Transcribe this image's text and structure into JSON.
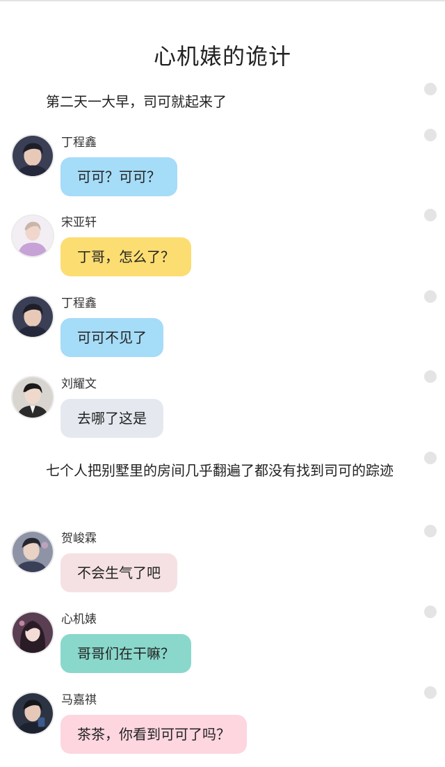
{
  "story": {
    "title": "心机婊的诡计"
  },
  "narrations": [
    {
      "text": "第二天一大早，司可就起来了"
    },
    {
      "text": "七个人把别墅里的房间几乎翻遍了都没有找到司可的踪迹"
    }
  ],
  "messages": [
    {
      "name": "丁程鑫",
      "text": "可可？可可？",
      "bubble_color": "#a5dcf8",
      "avatar": "avatar-ding-chengxin"
    },
    {
      "name": "宋亚轩",
      "text": "丁哥，怎么了？",
      "bubble_color": "#fcdd72",
      "avatar": "avatar-song-yaxuan"
    },
    {
      "name": "丁程鑫",
      "text": "可可不见了",
      "bubble_color": "#a5dcf8",
      "avatar": "avatar-ding-chengxin"
    },
    {
      "name": "刘耀文",
      "text": "去哪了这是",
      "bubble_color": "#e5e9ef",
      "avatar": "avatar-liu-yaowen"
    },
    {
      "name": "贺峻霖",
      "text": "不会生气了吧",
      "bubble_color": "#f5e1e3",
      "avatar": "avatar-he-junlin"
    },
    {
      "name": "心机婊",
      "text": "哥哥们在干嘛？",
      "bubble_color": "#89d8cb",
      "avatar": "avatar-xinjibiao"
    },
    {
      "name": "马嘉祺",
      "text": "茶茶，你看到可可了吗？",
      "bubble_color": "#fdd6e0",
      "avatar": "avatar-ma-jiaqi"
    }
  ]
}
